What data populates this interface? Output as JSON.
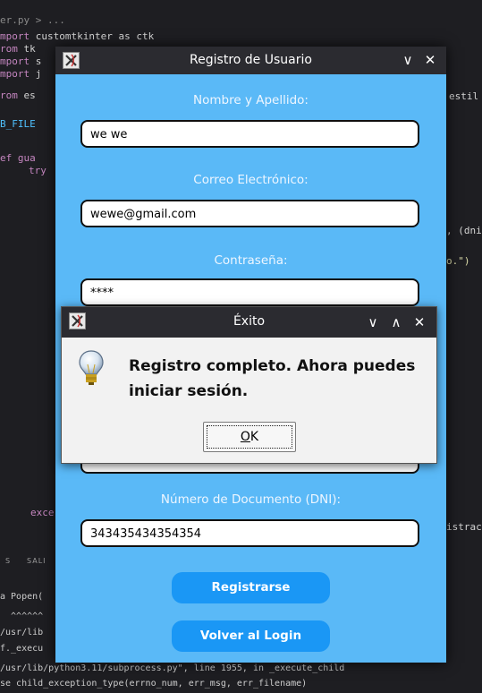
{
  "editor": {
    "breadcrumb": "er.py > ...",
    "code_lines": [
      {
        "kw": "mport",
        "rest": " customtkinter as ctk"
      },
      {
        "kw": "rom",
        "rest": " tk"
      },
      {
        "kw": "mport",
        "rest": " s"
      },
      {
        "kw": "mport",
        "rest": " j"
      },
      {
        "kw": "rom",
        "rest": " es"
      }
    ],
    "db_file": "B_FILE",
    "def_line": "ef gua",
    "try_line": "try",
    "exc_line": "exce",
    "right_frag_1": "estil",
    "right_frag_2": ", (dni",
    "right_frag_3": "o.\")",
    "right_frag_4": "istrac",
    "panel_tab_1": "S",
    "panel_tab_2": "SALI",
    "terminal_lines": [
      "a Popen(",
      "  ^^^^^^",
      "/usr/lib",
      "f._execu",
      "/usr/lib/python3.11/subprocess.py\", line 1955, in _execute_child",
      "se child_exception_type(errno_num, err_msg, err_filename)"
    ]
  },
  "main_window": {
    "title": "Registro de Usuario",
    "controls": {
      "minimize": "∨",
      "close": "✕"
    },
    "fields": [
      {
        "label": "Nombre y Apellido:",
        "value": "we we"
      },
      {
        "label": "Correo Electrónico:",
        "value": "wewe@gmail.com"
      },
      {
        "label": "Contraseña:",
        "value": "****"
      },
      {
        "label": "Número de Documento (DNI):",
        "value": "343435434354354"
      }
    ],
    "register_button": "Registrarse",
    "back_button": "Volver al Login"
  },
  "dialog": {
    "title": "Éxito",
    "controls": {
      "minimize": "∨",
      "maximize": "∧",
      "close": "✕"
    },
    "message_line_1": "Registro completo. Ahora puedes",
    "message_line_2": "iniciar sesión.",
    "ok_mnemonic": "O",
    "ok_rest": "K",
    "icon": "lightbulb-icon"
  }
}
